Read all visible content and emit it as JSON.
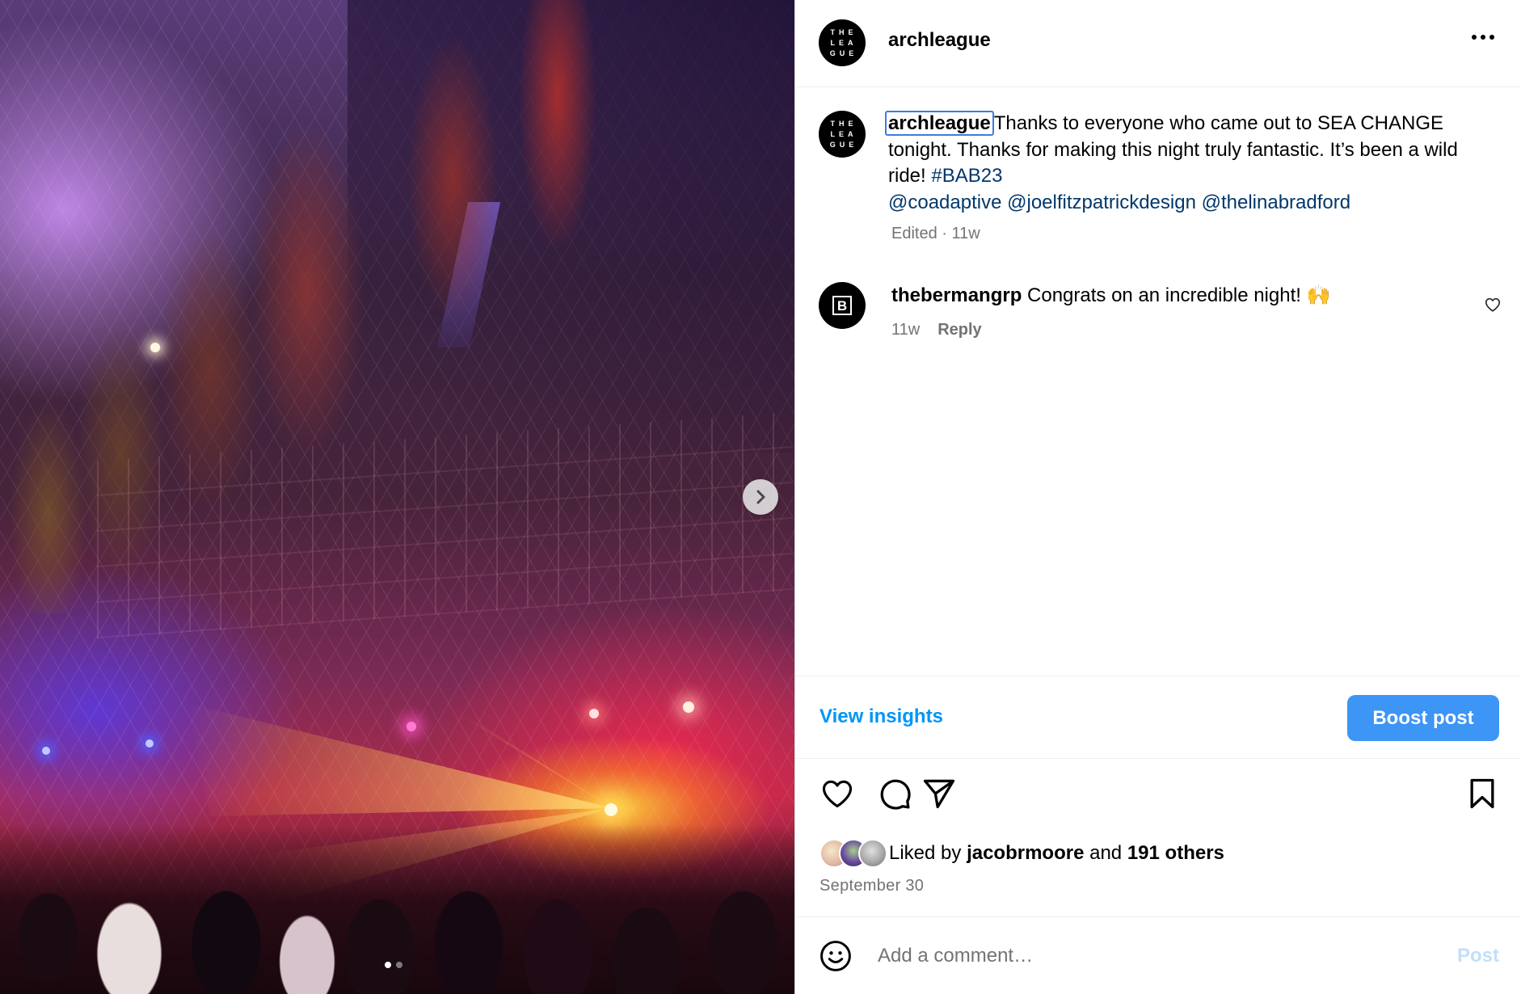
{
  "colors": {
    "link": "#00376b",
    "primary_blue": "#0095f6",
    "boost_button": "#3d95f5",
    "muted_text": "#737373",
    "post_disabled": "#c1dffc",
    "focus_ring": "#3d7be0"
  },
  "photo": {
    "carousel": {
      "slide_count": 2,
      "active_index": 0,
      "next_icon": "chevron-right-icon"
    }
  },
  "header": {
    "avatar_text": "THE LEA GUE",
    "username": "archleague",
    "more_icon": "more-horizontal-icon"
  },
  "caption": {
    "avatar_text": "THE LEA GUE",
    "username": "archleague",
    "text_part1": "Thanks to everyone who came out to SEA CHANGE tonight. Thanks for making this night truly fantastic. It’s been a wild ride! ",
    "hashtag": "#BAB23",
    "mentions": [
      "@coadaptive",
      "@joelfitzpatrickdesign",
      "@thelinabradford"
    ],
    "edited": "Edited",
    "separator": "·",
    "age": "11w"
  },
  "comment": {
    "avatar_letter": "B",
    "username": "thebermangrp",
    "text": "Congrats on an incredible night! 🙌",
    "age": "11w",
    "reply_label": "Reply",
    "like_icon": "heart-icon"
  },
  "insights": {
    "view_label": "View insights",
    "boost_label": "Boost post"
  },
  "actions": {
    "icons": [
      "heart-icon",
      "comment-icon",
      "share-icon",
      "bookmark-icon"
    ]
  },
  "likes": {
    "prefix": "Liked by",
    "user": "jacobrmoore",
    "conjunction": "and",
    "others": "191 others"
  },
  "post_date": "September 30",
  "comment_box": {
    "placeholder": "Add a comment…",
    "post_label": "Post",
    "emoji_icon": "smiley-icon"
  }
}
